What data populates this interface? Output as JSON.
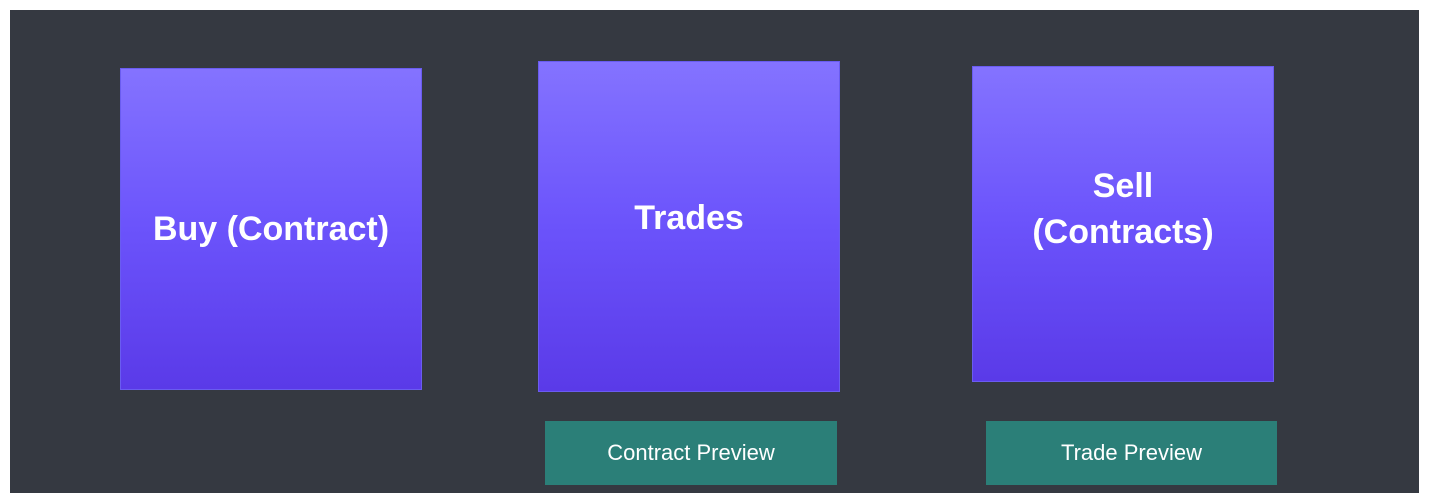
{
  "colors": {
    "background": "#353941",
    "card_gradient_top": "#8473ff",
    "card_gradient_bottom": "#5a3ae8",
    "preview_button": "#2b7f78",
    "text": "#ffffff"
  },
  "cards": {
    "buy": {
      "label": "Buy (Contract)"
    },
    "trades": {
      "label": "Trades"
    },
    "sell": {
      "label": "Sell\n(Contracts)"
    }
  },
  "previews": {
    "contract": {
      "label": "Contract Preview"
    },
    "trade": {
      "label": "Trade Preview"
    }
  }
}
